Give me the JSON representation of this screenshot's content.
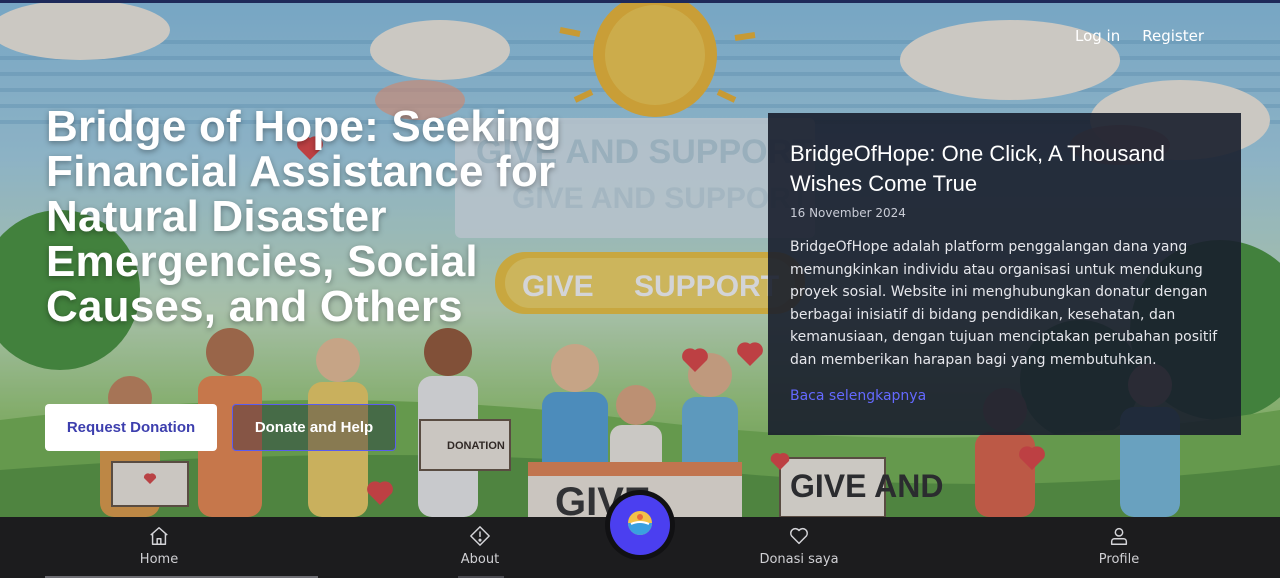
{
  "auth": {
    "login": "Log in",
    "register": "Register"
  },
  "hero": {
    "headline": "Bridge of Hope: Seeking Financial Assistance for Natural Disaster Emergencies, Social Causes, and Others",
    "request_button": "Request Donation",
    "donate_button": "Donate and Help",
    "illustration_text": {
      "banner_line1": "GIVE AND SUPPORT",
      "banner_line2": "GIVE AND SUPPORT",
      "banner_give": "GIVE",
      "banner_support": "SUPPORT",
      "box_label": "DONATION",
      "sign_label": "GIVE AND",
      "table_label": "GIVE"
    }
  },
  "card": {
    "title": "BridgeOfHope: One Click, A Thousand Wishes Come True",
    "date": "16 November 2024",
    "body": "BridgeOfHope adalah platform penggalangan dana yang memungkinkan individu atau organisasi untuk mendukung proyek sosial. Website ini menghubungkan donatur dengan berbagai inisiatif di bidang pendidikan, kesehatan, dan kemanusiaan, dengan tujuan menciptakan perubahan positif dan memberikan harapan bagi yang membutuhkan.",
    "link": "Baca selengkapnya"
  },
  "nav": {
    "items": [
      {
        "label": "Home",
        "icon": "home-icon"
      },
      {
        "label": "About",
        "icon": "info-diamond-icon"
      },
      {
        "label": "Donasi saya",
        "icon": "heart-icon"
      },
      {
        "label": "Profile",
        "icon": "user-icon"
      }
    ],
    "center_icon": "globe-logo-icon"
  },
  "colors": {
    "accent": "#4b3ff0",
    "link": "#6469ff",
    "card_bg": "#181e2c",
    "nav_bg": "#1c1c1e",
    "primary_button_text": "#3d3fae"
  }
}
